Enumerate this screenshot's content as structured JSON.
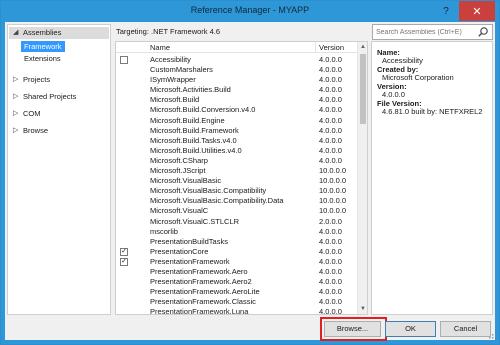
{
  "window": {
    "title": "Reference Manager - MYAPP",
    "help_glyph": "?",
    "close_glyph": "✕"
  },
  "nav": {
    "header": "Assemblies",
    "sub_items": [
      "Framework",
      "Extensions"
    ],
    "items": [
      "Projects",
      "Shared Projects",
      "COM",
      "Browse"
    ]
  },
  "target": "Targeting: .NET Framework 4.6",
  "search": {
    "placeholder": "Search Assemblies (Ctrl+E)"
  },
  "list": {
    "col_name": "Name",
    "col_version": "Version",
    "rows": [
      {
        "name": "Accessibility",
        "version": "4.0.0.0",
        "checked": false,
        "box": true
      },
      {
        "name": "CustomMarshalers",
        "version": "4.0.0.0",
        "checked": false,
        "box": false
      },
      {
        "name": "ISymWrapper",
        "version": "4.0.0.0",
        "checked": false,
        "box": false
      },
      {
        "name": "Microsoft.Activities.Build",
        "version": "4.0.0.0",
        "checked": false,
        "box": false
      },
      {
        "name": "Microsoft.Build",
        "version": "4.0.0.0",
        "checked": false,
        "box": false
      },
      {
        "name": "Microsoft.Build.Conversion.v4.0",
        "version": "4.0.0.0",
        "checked": false,
        "box": false
      },
      {
        "name": "Microsoft.Build.Engine",
        "version": "4.0.0.0",
        "checked": false,
        "box": false
      },
      {
        "name": "Microsoft.Build.Framework",
        "version": "4.0.0.0",
        "checked": false,
        "box": false
      },
      {
        "name": "Microsoft.Build.Tasks.v4.0",
        "version": "4.0.0.0",
        "checked": false,
        "box": false
      },
      {
        "name": "Microsoft.Build.Utilities.v4.0",
        "version": "4.0.0.0",
        "checked": false,
        "box": false
      },
      {
        "name": "Microsoft.CSharp",
        "version": "4.0.0.0",
        "checked": false,
        "box": false
      },
      {
        "name": "Microsoft.JScript",
        "version": "10.0.0.0",
        "checked": false,
        "box": false
      },
      {
        "name": "Microsoft.VisualBasic",
        "version": "10.0.0.0",
        "checked": false,
        "box": false
      },
      {
        "name": "Microsoft.VisualBasic.Compatibility",
        "version": "10.0.0.0",
        "checked": false,
        "box": false
      },
      {
        "name": "Microsoft.VisualBasic.Compatibility.Data",
        "version": "10.0.0.0",
        "checked": false,
        "box": false
      },
      {
        "name": "Microsoft.VisualC",
        "version": "10.0.0.0",
        "checked": false,
        "box": false
      },
      {
        "name": "Microsoft.VisualC.STLCLR",
        "version": "2.0.0.0",
        "checked": false,
        "box": false
      },
      {
        "name": "mscorlib",
        "version": "4.0.0.0",
        "checked": false,
        "box": false
      },
      {
        "name": "PresentationBuildTasks",
        "version": "4.0.0.0",
        "checked": false,
        "box": false
      },
      {
        "name": "PresentationCore",
        "version": "4.0.0.0",
        "checked": true,
        "box": true
      },
      {
        "name": "PresentationFramework",
        "version": "4.0.0.0",
        "checked": true,
        "box": true
      },
      {
        "name": "PresentationFramework.Aero",
        "version": "4.0.0.0",
        "checked": false,
        "box": false
      },
      {
        "name": "PresentationFramework.Aero2",
        "version": "4.0.0.0",
        "checked": false,
        "box": false
      },
      {
        "name": "PresentationFramework.AeroLite",
        "version": "4.0.0.0",
        "checked": false,
        "box": false
      },
      {
        "name": "PresentationFramework.Classic",
        "version": "4.0.0.0",
        "checked": false,
        "box": false
      },
      {
        "name": "PresentationFramework.Luna",
        "version": "4.0.0.0",
        "checked": false,
        "box": false
      }
    ]
  },
  "details": {
    "name_label": "Name:",
    "name_value": "Accessibility",
    "created_by_label": "Created by:",
    "created_by_value": "Microsoft Corporation",
    "version_label": "Version:",
    "version_value": "4.0.0.0",
    "file_version_label": "File Version:",
    "file_version_value": "4.6.81.0 built by: NETFXREL2"
  },
  "buttons": {
    "browse": "Browse...",
    "ok": "OK",
    "cancel": "Cancel"
  },
  "colors": {
    "title_bar": "#2e97d8",
    "selection": "#3399ff",
    "close": "#c9403c",
    "highlight": "#e02020"
  }
}
